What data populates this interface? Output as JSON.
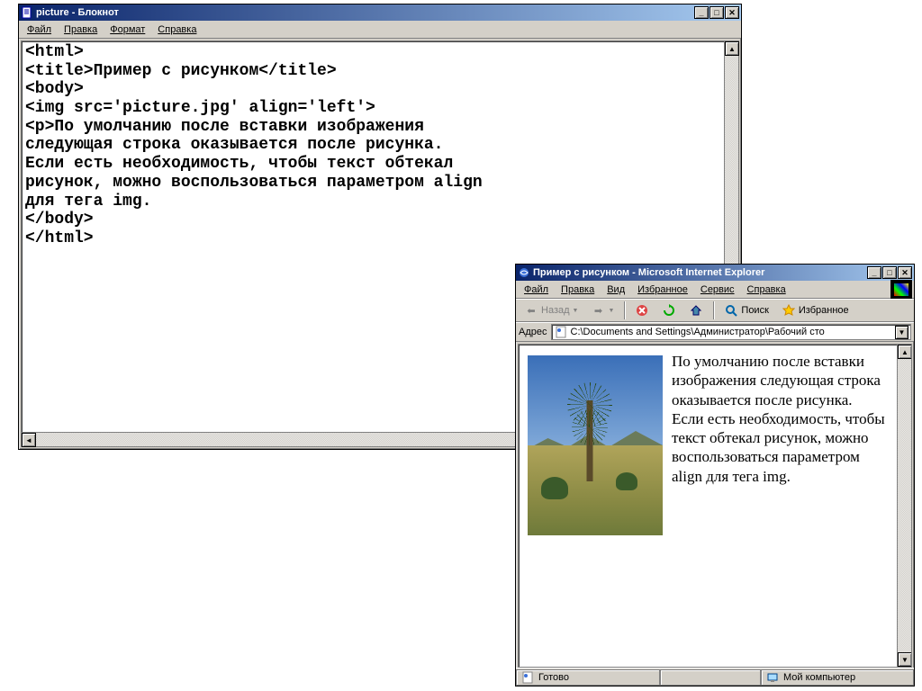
{
  "notepad": {
    "title": "picture - Блокнот",
    "menu": [
      "Файл",
      "Правка",
      "Формат",
      "Справка"
    ],
    "content": "<html>\n<title>Пример с рисунком</title>\n<body>\n<img src='picture.jpg' align='left'>\n<p>По умолчанию после вставки изображения\nследующая строка оказывается после рисунка.\nЕсли есть необходимость, чтобы текст обтекал\nрисунок, можно воспользоваться параметром align\nдля тега img.\n</body>\n</html>"
  },
  "ie": {
    "title": "Пример с рисунком - Microsoft Internet Explorer",
    "menu": [
      "Файл",
      "Правка",
      "Вид",
      "Избранное",
      "Сервис",
      "Справка"
    ],
    "toolbar": {
      "back": "Назад",
      "search": "Поиск",
      "favorites": "Избранное"
    },
    "address_label": "Адрес",
    "address_value": "C:\\Documents and Settings\\Администратор\\Рабочий сто",
    "page_text": "По умолчанию после вставки изображения следующая строка оказывается после рисунка. Если есть необходимость, чтобы текст обтекал рисунок, можно воспользоваться параметром align для тега img.",
    "status_ready": "Готово",
    "status_zone": "Мой компьютер"
  },
  "winbtns": {
    "min": "_",
    "max": "□",
    "close": "✕"
  }
}
